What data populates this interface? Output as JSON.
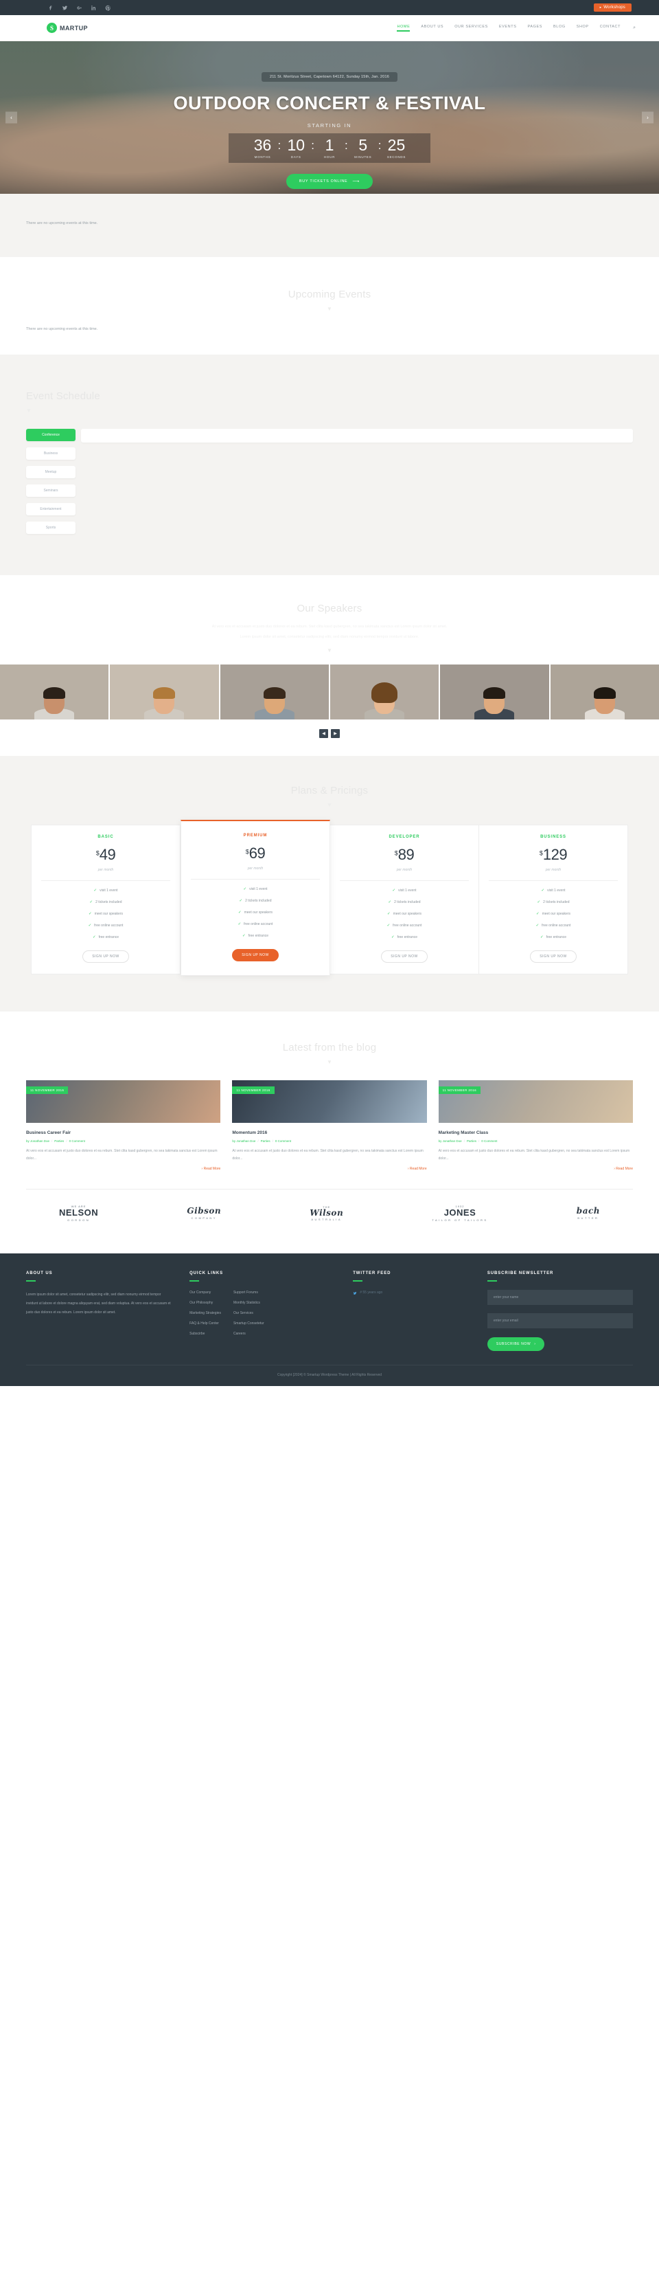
{
  "topbar": {
    "social": [
      {
        "name": "facebook-icon",
        "glyph": "f"
      },
      {
        "name": "twitter-icon",
        "glyph": "t"
      },
      {
        "name": "google-plus-icon",
        "glyph": "g"
      },
      {
        "name": "linkedin-icon",
        "glyph": "in"
      },
      {
        "name": "pinterest-icon",
        "glyph": "p"
      }
    ],
    "workshops_label": "Workshops"
  },
  "header": {
    "logo_mark": "S",
    "logo_text": "MARTUP",
    "nav": [
      {
        "label": "HOME",
        "active": true
      },
      {
        "label": "ABOUT US",
        "active": false
      },
      {
        "label": "OUR SERVICES",
        "active": false
      },
      {
        "label": "EVENTS",
        "active": false
      },
      {
        "label": "PAGES",
        "active": false
      },
      {
        "label": "BLOG",
        "active": false
      },
      {
        "label": "SHOP",
        "active": false
      },
      {
        "label": "CONTACT",
        "active": false
      }
    ],
    "search_icon": "⌕"
  },
  "hero": {
    "address": "211 St. Moritzus Street, Capetown 64122, Sunday 15th, Jan. 2016",
    "title": "OUTDOOR CONCERT & FESTIVAL",
    "starting_in": "STARTING IN",
    "countdown": [
      {
        "value": "36",
        "label": "MONTHS"
      },
      {
        "value": "10",
        "label": "DAYS"
      },
      {
        "value": "1",
        "label": "HOUR"
      },
      {
        "value": "5",
        "label": "MINUTES"
      },
      {
        "value": "25",
        "label": "SECONDS"
      }
    ],
    "separator": ":",
    "cta_label": "BUY TICKETS ONLINE",
    "prev_glyph": "‹",
    "next_glyph": "›"
  },
  "events_strip": {
    "empty_message": "There are no upcoming events at this time."
  },
  "upcoming": {
    "title": "Upcoming Events",
    "empty_message": "There are no upcoming events at this time."
  },
  "schedule": {
    "title": "Event Schedule",
    "tabs": [
      {
        "label": "Conference",
        "active": true
      },
      {
        "label": "Business",
        "active": false
      },
      {
        "label": "Meetup",
        "active": false
      },
      {
        "label": "Seminars",
        "active": false
      },
      {
        "label": "Entertainment",
        "active": false
      },
      {
        "label": "Sports",
        "active": false
      }
    ]
  },
  "speakers": {
    "title": "Our Speakers",
    "sub1": "At vero eos et accusam et justo duo dolores et ea rebum. Stet clita kasd gubergren, no sea takimata sanctus est Lorem ipsum dolor sit amet.",
    "sub2": "Lorem ipsum dolor sit amet, consetetur sadipscing elitr, sed diam nonumy eirmod tempor invidunt ut labore.",
    "items": [
      {
        "name": "speaker-1",
        "skin": "#c8906c",
        "hair": "#2b2119",
        "body": "#d8d5cf",
        "bg": "#b9b0a4"
      },
      {
        "name": "speaker-2",
        "skin": "#e3b08a",
        "hair": "#b07a3a",
        "body": "#cfc9c0",
        "bg": "#c7bdb0"
      },
      {
        "name": "speaker-3",
        "skin": "#dda878",
        "hair": "#3a2a1c",
        "body": "#8d99a2",
        "bg": "#a8a097"
      },
      {
        "name": "speaker-4",
        "skin": "#e8b992",
        "hair": "#6d4620",
        "body": "#b9b4ab",
        "bg": "#b3aaa0"
      },
      {
        "name": "speaker-5",
        "skin": "#e0ab7f",
        "hair": "#241c14",
        "body": "#3d4650",
        "bg": "#9f978f"
      },
      {
        "name": "speaker-6",
        "skin": "#d79c72",
        "hair": "#1e1811",
        "body": "#e2ddd6",
        "bg": "#ada498"
      }
    ]
  },
  "pricing": {
    "title": "Plans & Pricings",
    "plans": [
      {
        "name": "BASIC",
        "currency": "$",
        "amount": "49",
        "per": "per month",
        "features": [
          "visit 1 event",
          "2 tickets included",
          "meet our speakers",
          "free online account",
          "free entrance"
        ],
        "button": "SIGN UP NOW",
        "featured": false
      },
      {
        "name": "PREMIUM",
        "currency": "$",
        "amount": "69",
        "per": "per month",
        "features": [
          "visit 1 event",
          "2 tickets included",
          "meet our speakers",
          "free online account",
          "free entrance"
        ],
        "button": "SIGN UP NOW",
        "featured": true
      },
      {
        "name": "DEVELOPER",
        "currency": "$",
        "amount": "89",
        "per": "per month",
        "features": [
          "visit 1 event",
          "2 tickets included",
          "meet our speakers",
          "free online account",
          "free entrance"
        ],
        "button": "SIGN UP NOW",
        "featured": false
      },
      {
        "name": "BUSINESS",
        "currency": "$",
        "amount": "129",
        "per": "per month",
        "features": [
          "visit 1 event",
          "2 tickets included",
          "meet our speakers",
          "free online account",
          "free entrance"
        ],
        "button": "SIGN UP NOW",
        "featured": false
      }
    ]
  },
  "blog": {
    "title": "Latest from the blog",
    "posts": [
      {
        "date": "11 NOVEMBER 2016",
        "title": "Business Career Fair",
        "author": "by Jonathan Doe",
        "category": "Parties",
        "comments": "0 Comment",
        "excerpt": "At vero eos et accusam et justo duo dolores et ea rebum. Stet clita kasd gubergren, no sea takimata sanctus est Lorem ipsum dolor...",
        "read_more": "Read More",
        "img_a": "#5b6673",
        "img_b": "#cfa283"
      },
      {
        "date": "11 NOVEMBER 2016",
        "title": "Momentum 2016",
        "author": "by Jonathan Doe",
        "category": "Parties",
        "comments": "0 Comment",
        "excerpt": "At vero eos et accusam et justo duo dolores et ea rebum. Stet clita kasd gubergren, no sea takimata sanctus est Lorem ipsum dolor...",
        "read_more": "Read More",
        "img_a": "#2f3a46",
        "img_b": "#9fb3c4"
      },
      {
        "date": "11 NOVEMBER 2016",
        "title": "Marketing Master Class",
        "author": "by Jonathan Doe",
        "category": "Parties",
        "comments": "0 Comment",
        "excerpt": "At vero eos et accusam et justo duo dolores et ea rebum. Stet clita kasd gubergren, no sea takimata sanctus est Lorem ipsum dolor...",
        "read_more": "Read More",
        "img_a": "#8b98a4",
        "img_b": "#d8c3a5"
      }
    ]
  },
  "brands": [
    {
      "top": "WE ARE",
      "main": "NELSON",
      "bottom": "GORDON",
      "script": false
    },
    {
      "top": "",
      "main": "Gibson",
      "bottom": "COMPANY",
      "script": true
    },
    {
      "top": "THE",
      "main": "Wilson",
      "bottom": "AUSTRALIA",
      "script": false
    },
    {
      "top": "1932",
      "main": "JONES",
      "bottom": "TAILOR OF TAILORS",
      "script": false
    },
    {
      "top": "",
      "main": "bach",
      "bottom": "BUTTER",
      "script": true
    }
  ],
  "footer": {
    "about": {
      "heading": "ABOUT US",
      "text": "Lorem ipsum dolor sit amet, consetetur sadipscing elitr, sed diam nonumy eirmod tempor invidunt ut labore et dolore magna aliquyam erat, sed diam voluptua. At vero eos et accusam et justo duo dolores et ea rebum. Lorem ipsum dolor sit amet."
    },
    "quick_links": {
      "heading": "QUICK LINKS",
      "col1": [
        "Our Company",
        "Our Philosophy",
        "Marketing Strategies",
        "FAQ & Help Center",
        "Subscirbe"
      ],
      "col2": [
        "Support Forums",
        "Monthly Statistics",
        "Our Services",
        "Smartup Consetetur",
        "Careers"
      ]
    },
    "twitter": {
      "heading": "TWITTER FEED",
      "tweet": "# 55 years ago"
    },
    "newsletter": {
      "heading": "SUBSCRIBE NEWSLETTER",
      "name_placeholder": "enter your name",
      "email_placeholder": "enter your email",
      "button": "SUBSCRIBE NOW"
    },
    "copyright": "Copyright [2024] © Smartup Wordpress Theme | All Rights Reserved"
  }
}
